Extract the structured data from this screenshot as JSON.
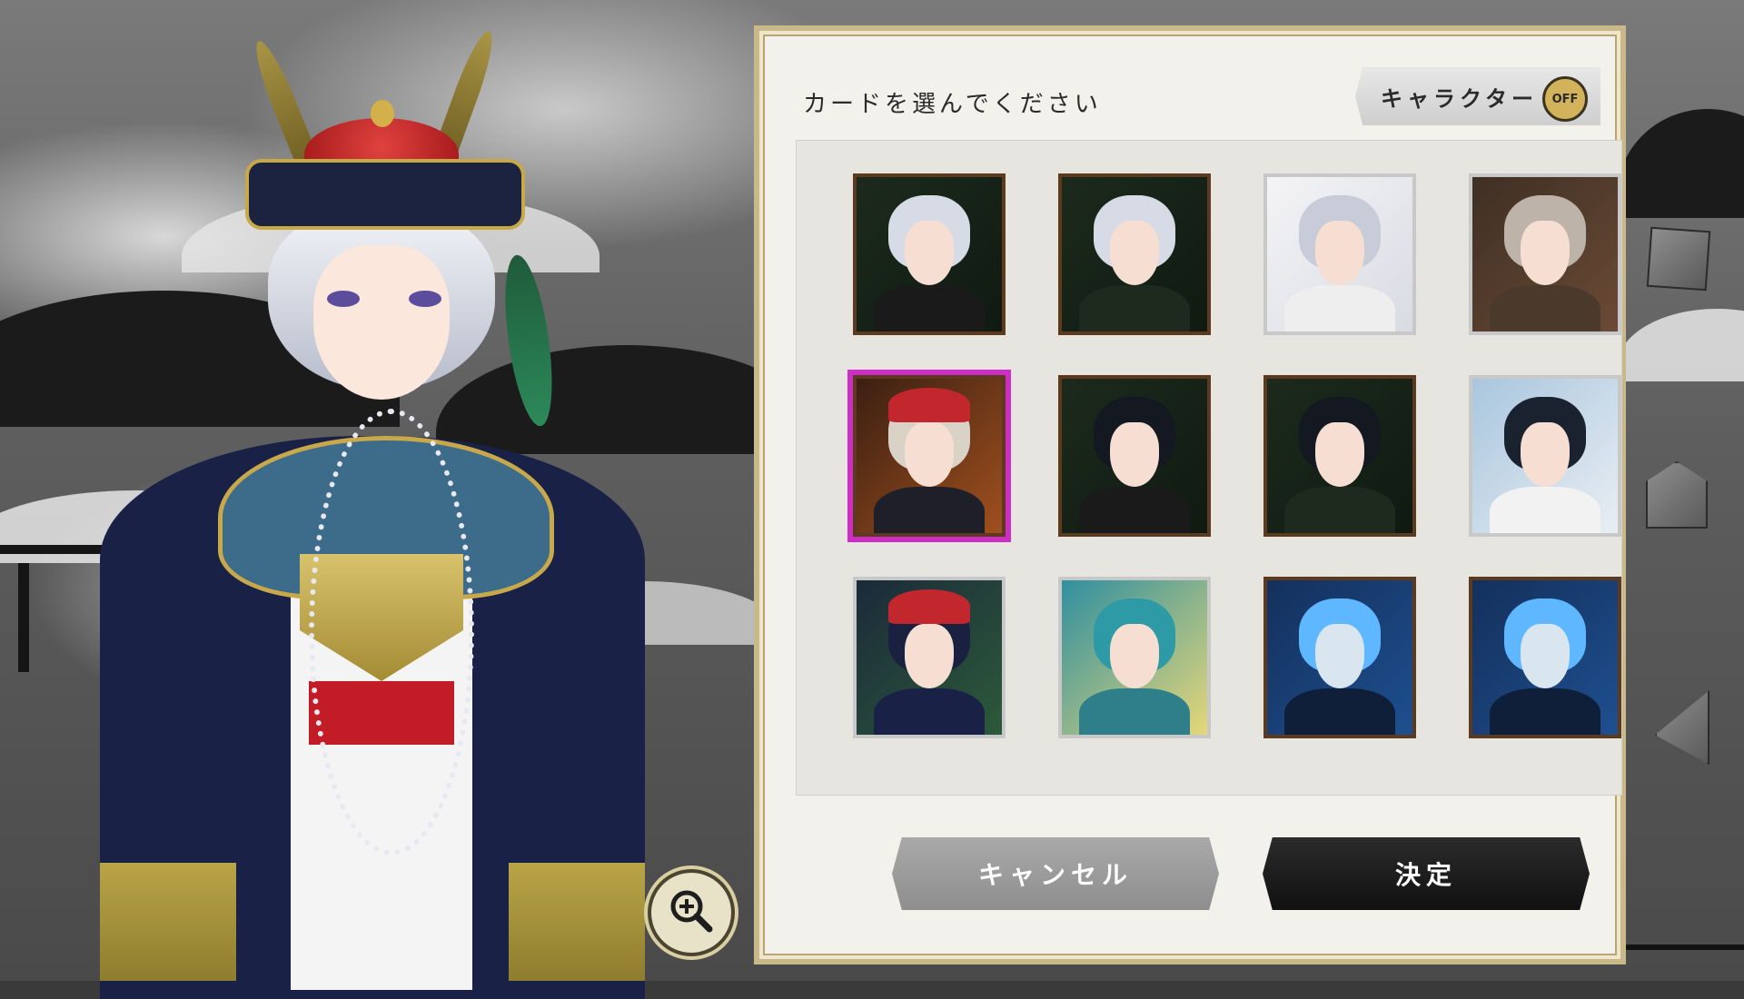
{
  "dialog": {
    "title": "カードを選んでください",
    "character_filter_label": "キャラクター",
    "character_filter_state": "OFF",
    "cancel_label": "キャンセル",
    "confirm_label": "決定"
  },
  "cards": [
    {
      "id": "card-1",
      "theme": "silver-hair-green",
      "selected": false
    },
    {
      "id": "card-2",
      "theme": "silver-hair-green",
      "selected": false
    },
    {
      "id": "card-3",
      "theme": "silver-hair-white",
      "selected": false
    },
    {
      "id": "card-4",
      "theme": "silver-hair-purple",
      "selected": false
    },
    {
      "id": "card-5",
      "theme": "red-hat-orange",
      "selected": true
    },
    {
      "id": "card-6",
      "theme": "black-hair-green",
      "selected": false
    },
    {
      "id": "card-7",
      "theme": "black-hair-green",
      "selected": false
    },
    {
      "id": "card-8",
      "theme": "black-hair-white",
      "selected": false
    },
    {
      "id": "card-9",
      "theme": "red-hat-navy",
      "selected": false
    },
    {
      "id": "card-10",
      "theme": "teal-hood",
      "selected": false
    },
    {
      "id": "card-11",
      "theme": "blue-flame-mask",
      "selected": false
    },
    {
      "id": "card-12",
      "theme": "blue-flame-mask",
      "selected": false
    }
  ],
  "colors": {
    "selected_outline": "#cf2ec4",
    "card_frame": "#5b3a1f",
    "confirm_button": "#1a1a1a",
    "cancel_button": "#9a9a9a",
    "toggle_off": "#d3b25c"
  },
  "icons": {
    "zoom": "zoom-in-icon"
  }
}
